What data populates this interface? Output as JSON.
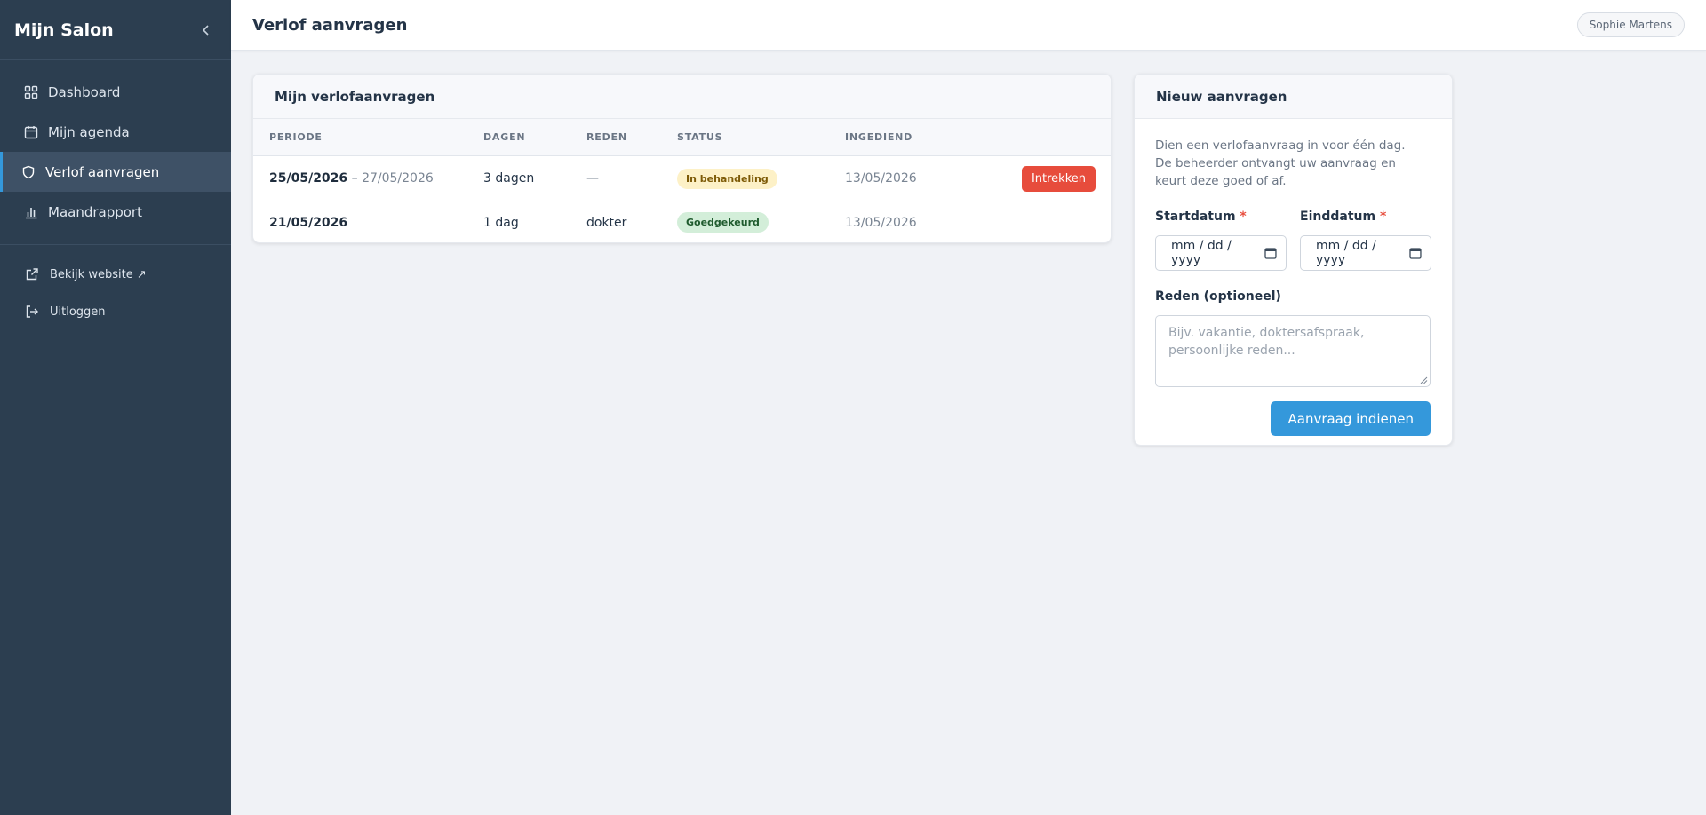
{
  "sidebar": {
    "brand": "Mijn Salon",
    "items": [
      {
        "label": "Dashboard",
        "icon": "grid-icon"
      },
      {
        "label": "Mijn agenda",
        "icon": "calendar-icon"
      },
      {
        "label": "Verlof aanvragen",
        "icon": "shield-icon",
        "active": true
      },
      {
        "label": "Maandrapport",
        "icon": "bar-chart-icon"
      }
    ],
    "secondary": [
      {
        "label": "Bekijk website ↗",
        "icon": "external-link-icon"
      },
      {
        "label": "Uitloggen",
        "icon": "logout-icon"
      }
    ]
  },
  "header": {
    "title": "Verlof aanvragen",
    "user": "Sophie Martens"
  },
  "requests": {
    "title": "Mijn verlofaanvragen",
    "columns": [
      "PERIODE",
      "DAGEN",
      "REDEN",
      "STATUS",
      "INGEDIEND",
      ""
    ],
    "rows": [
      {
        "start": "25/05/2026",
        "sep": " – ",
        "end": "27/05/2026",
        "days": "3 dagen",
        "reason": "—",
        "status": "In behandeling",
        "submitted": "13/05/2026",
        "action": "Intrekken"
      },
      {
        "start": "21/05/2026",
        "sep": "",
        "end": "",
        "days": "1 dag",
        "reason": "dokter",
        "status": "Goedgekeurd",
        "submitted": "13/05/2026",
        "action": ""
      }
    ]
  },
  "form": {
    "title": "Nieuw aanvragen",
    "intro": "Dien een verlofaanvraag in voor één dag. De beheerder ontvangt uw aanvraag en keurt deze goed of af.",
    "start_label": "Startdatum",
    "end_label": "Einddatum",
    "required_mark": "*",
    "date_placeholder": "mm / dd / yyyy",
    "reason_label": "Reden (optioneel)",
    "reason_placeholder": "Bijv. vakantie, doktersafspraak, persoonlijke reden...",
    "submit": "Aanvraag indienen"
  },
  "colors": {
    "sidebar_bg": "#2c3e50",
    "accent": "#3498db",
    "danger": "#e74c3c",
    "pending_bg": "#fdf1c7",
    "approved_bg": "#d3eed9"
  }
}
